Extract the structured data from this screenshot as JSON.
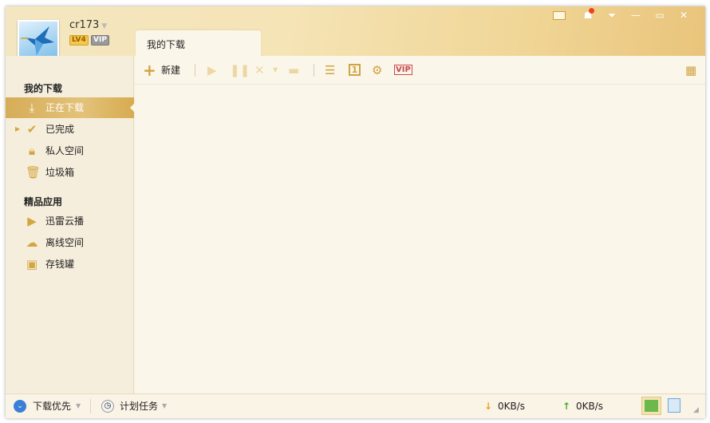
{
  "user": {
    "name": "cr173",
    "level": "LV4",
    "vip": "VIP"
  },
  "window_controls": [
    "mail-icon",
    "skin-icon",
    "menu-icon",
    "minimize-icon",
    "maximize-icon",
    "close-icon"
  ],
  "tab": {
    "label": "我的下载"
  },
  "toolbar": {
    "new_label": "新建"
  },
  "sidebar": {
    "section1": "我的下载",
    "items": [
      {
        "label": "正在下载"
      },
      {
        "label": "已完成"
      },
      {
        "label": "私人空间"
      },
      {
        "label": "垃圾箱"
      }
    ],
    "section2": "精品应用",
    "apps": [
      {
        "label": "迅雷云播"
      },
      {
        "label": "离线空间"
      },
      {
        "label": "存钱罐"
      }
    ]
  },
  "status": {
    "priority": "下载优先",
    "schedule": "计划任务",
    "down_speed": "0KB/s",
    "up_speed": "0KB/s"
  },
  "colors": {
    "accent": "#d2a640",
    "selected": "#d9b05c"
  }
}
